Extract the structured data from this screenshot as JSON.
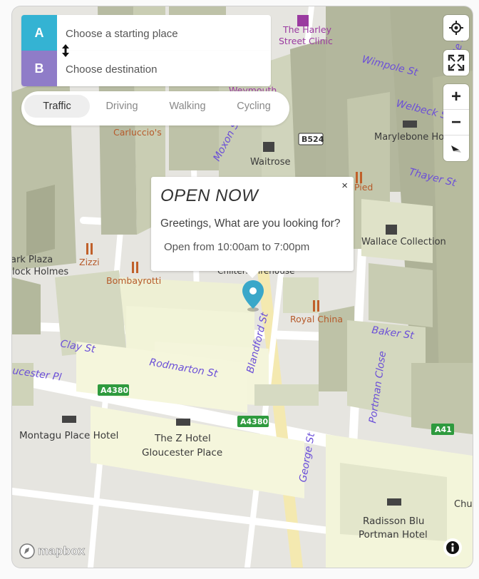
{
  "route": {
    "a_letter": "A",
    "b_letter": "B",
    "start_placeholder": "Choose a starting place",
    "dest_placeholder": "Choose destination"
  },
  "modes": [
    {
      "label": "Traffic",
      "active": true
    },
    {
      "label": "Driving",
      "active": false
    },
    {
      "label": "Walking",
      "active": false
    },
    {
      "label": "Cycling",
      "active": false
    }
  ],
  "controls": {
    "geolocate_icon": "crosshair-icon",
    "fullscreen_icon": "fullscreen-icon",
    "zoom_in": "+",
    "zoom_out": "−",
    "compass_icon": "compass-icon"
  },
  "popup": {
    "title": "OPEN NOW",
    "close": "×",
    "greeting": "Greetings, What are you looking for?",
    "hours": "Open from 10:00am to 7:00pm"
  },
  "map_labels": {
    "roads": [
      "Wimpole St",
      "Welbeck St",
      "Moxon St",
      "Thayer St",
      "Baker St",
      "Clay St",
      "Rodmarton St",
      "Blandford St",
      "Portman Close",
      "George St",
      "ucester Pl",
      "Weymouth",
      "ole St"
    ],
    "pois": [
      "The Harley Street Clinic",
      "Carluccio's",
      "Waitrose",
      "Pied",
      "Zizzi",
      "Bombayrotti",
      "Royal China",
      "Chiltern Firehouse",
      "Wallace Collection",
      "Marylebone Ho",
      "Montagu Place Hotel",
      "The Z Hotel Gloucester Place",
      "Radisson Blu Portman Hotel",
      "ark Plaza",
      "lock Holmes",
      "Chu"
    ],
    "shields": [
      "B524",
      "A4380",
      "A4380",
      "A41"
    ]
  },
  "attribution": {
    "logo_text": "mapbox",
    "info_icon": "info-icon"
  },
  "colors": {
    "accent_a": "#34b3d3",
    "accent_b": "#8f7cc8",
    "marker": "#3aa7c9",
    "road_label": "#6b4fd8"
  }
}
